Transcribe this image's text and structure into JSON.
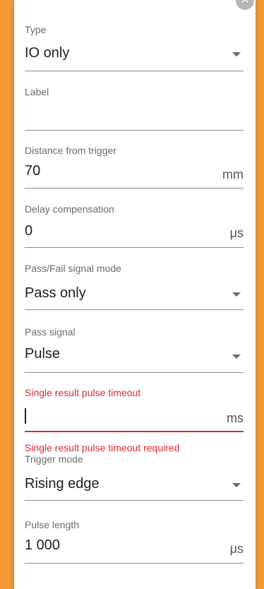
{
  "close_icon": "close-icon",
  "fields": {
    "type": {
      "label": "Type",
      "value": "IO only"
    },
    "label": {
      "label": "Label",
      "value": ""
    },
    "distance": {
      "label": "Distance from trigger",
      "value": "70",
      "unit": "mm"
    },
    "delay": {
      "label": "Delay compensation",
      "value": "0",
      "unit": "μs"
    },
    "passfail": {
      "label": "Pass/Fail signal mode",
      "value": "Pass only"
    },
    "pass_signal": {
      "label": "Pass signal",
      "value": "Pulse"
    },
    "timeout": {
      "label": "Single result pulse timeout",
      "value": "",
      "unit": "ms",
      "error": "Single result pulse timeout required"
    },
    "trigger_mode": {
      "label": "Trigger mode",
      "value": "Rising edge"
    },
    "pulse_length": {
      "label": "Pulse length",
      "value": "1 000",
      "unit": "μs"
    }
  },
  "colors": {
    "accent_orange": "#f39a36",
    "error_red": "#d32f2f"
  }
}
